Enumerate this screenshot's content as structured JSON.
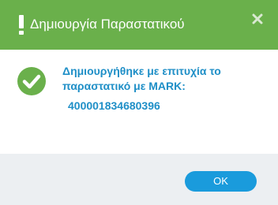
{
  "dialog": {
    "title": "Δημιουργία Παραστατικού",
    "header_icon": "exclamation-icon",
    "close_icon": "close-icon",
    "colors": {
      "header": "#6ab04b",
      "success_icon": "#6ab04b",
      "message_text": "#1f8fc7",
      "ok_button": "#1a9bdc",
      "footer": "#eceff2"
    }
  },
  "body": {
    "status_icon": "checkmark-circle-icon",
    "message": "Δημιουργήθηκε με επιτυχία το παραστατικό με MARK:",
    "mark_value": "400001834680396"
  },
  "footer": {
    "ok_label": "OK"
  }
}
